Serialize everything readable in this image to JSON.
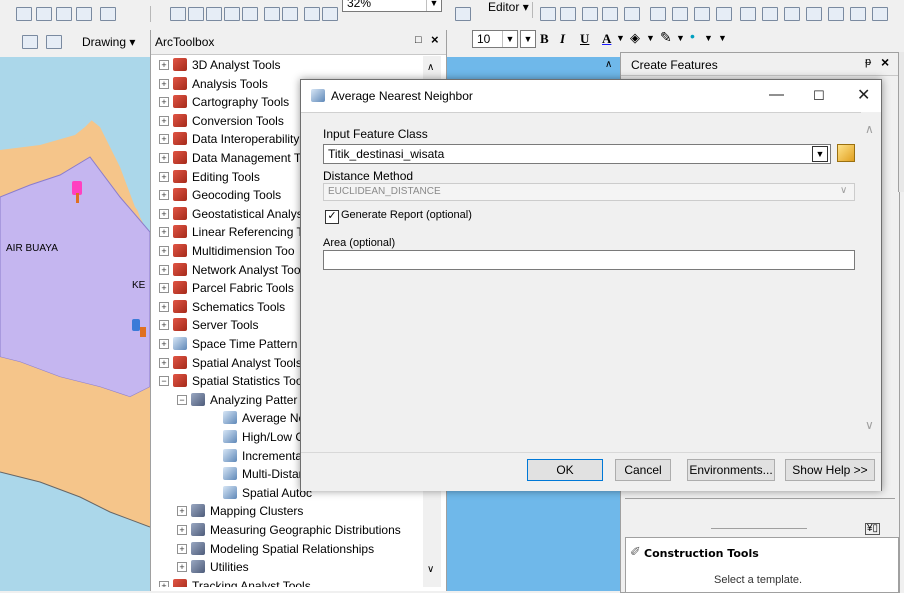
{
  "toolbar": {
    "drawing_label": "Drawing",
    "zoom_value": "32%",
    "editor_label": "Editor",
    "font_size_value": "10",
    "bold_label": "B",
    "italic_label": "I",
    "underline_label": "U",
    "font_color_label": "A"
  },
  "map": {
    "place_label_1": "AIR BUAYA",
    "place_label_2": "KE"
  },
  "toolbox": {
    "title": "ArcToolbox",
    "items": [
      {
        "label": "3D Analyst Tools"
      },
      {
        "label": "Analysis Tools"
      },
      {
        "label": "Cartography Tools"
      },
      {
        "label": "Conversion Tools"
      },
      {
        "label": "Data Interoperability"
      },
      {
        "label": "Data Management T"
      },
      {
        "label": "Editing Tools"
      },
      {
        "label": "Geocoding Tools"
      },
      {
        "label": "Geostatistical Analys"
      },
      {
        "label": "Linear Referencing T"
      },
      {
        "label": "Multidimension Too"
      },
      {
        "label": "Network Analyst Too"
      },
      {
        "label": "Parcel Fabric Tools"
      },
      {
        "label": "Schematics Tools"
      },
      {
        "label": "Server Tools"
      },
      {
        "label": "Space Time Pattern I"
      },
      {
        "label": "Spatial Analyst Tools"
      },
      {
        "label": "Spatial Statistics Too"
      },
      {
        "label": "Analyzing Patter"
      },
      {
        "label": "Average Nea"
      },
      {
        "label": "High/Low Cl"
      },
      {
        "label": "Incremental S"
      },
      {
        "label": "Multi-Distanc"
      },
      {
        "label": "Spatial Autoc"
      },
      {
        "label": "Mapping Clusters"
      },
      {
        "label": "Measuring Geographic Distributions"
      },
      {
        "label": "Modeling Spatial Relationships"
      },
      {
        "label": "Utilities"
      },
      {
        "label": "Tracking Analyst Tools"
      }
    ]
  },
  "create_features": {
    "title": "Create Features",
    "construction_tools_label": "Construction Tools",
    "select_template_text": "Select a template."
  },
  "dialog": {
    "title": "Average Nearest Neighbor",
    "input_feature_class_label": "Input Feature Class",
    "input_feature_class_value": "Titik_destinasi_wisata",
    "distance_method_label": "Distance Method",
    "distance_method_value": "EUCLIDEAN_DISTANCE",
    "generate_report_label": "Generate Report (optional)",
    "generate_report_checked": true,
    "area_label": "Area (optional)",
    "area_value": "",
    "ok_label": "OK",
    "cancel_label": "Cancel",
    "environments_label": "Environments...",
    "show_help_label": "Show Help >>"
  },
  "colors": {
    "map_land": "#c5b6f0",
    "map_land_orange": "#f5c58a",
    "map_water": "#6fb8ea",
    "map_water_light": "#abd7ea"
  }
}
